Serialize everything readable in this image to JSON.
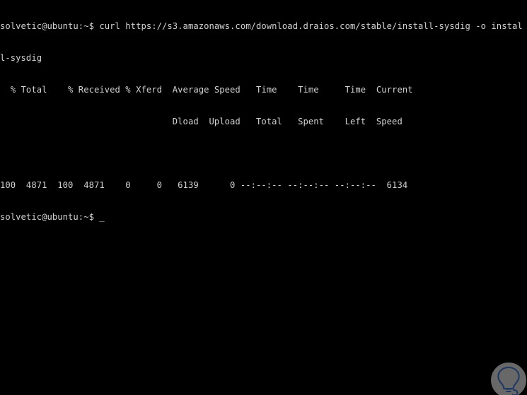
{
  "terminal": {
    "background_color": "#000000",
    "text_color": "#d2d2d2",
    "lines": [
      "solvetic@ubuntu:~$ curl https://s3.amazonaws.com/download.draios.com/stable/install-sysdig -o instal",
      "l-sysdig",
      "  % Total    % Received % Xferd  Average Speed   Time    Time     Time  Current",
      "                                 Dload  Upload   Total   Spent    Left  Speed",
      "",
      "100  4871  100  4871    0     0   6139      0 --:--:-- --:--:-- --:--:--  6134",
      "solvetic@ubuntu:~$ "
    ],
    "prompt": "solvetic@ubuntu:~$",
    "command": "curl https://s3.amazonaws.com/download.draios.com/stable/install-sysdig -o install-sysdig",
    "cursor": "_",
    "progress_table": {
      "headers_row1": [
        "% Total",
        "% Received",
        "% Xferd",
        "Average Speed",
        "Time",
        "Time",
        "Time",
        "Current"
      ],
      "headers_row2": [
        "Dload",
        "Upload",
        "Total",
        "Spent",
        "Left",
        "Speed"
      ],
      "values": {
        "percent_total": "100",
        "total": "4871",
        "percent_received": "100",
        "received": "4871",
        "percent_xferd": "0",
        "xferd": "0",
        "average_speed_dload": "6139",
        "average_speed_upload": "0",
        "time_total": "--:--:--",
        "time_spent": "--:--:--",
        "time_left": "--:--:--",
        "current_speed": "6134"
      }
    }
  },
  "watermark": {
    "name": "solvetic-logo",
    "circle_color": "#6e6e6e",
    "mark_color": "#1f3864"
  }
}
